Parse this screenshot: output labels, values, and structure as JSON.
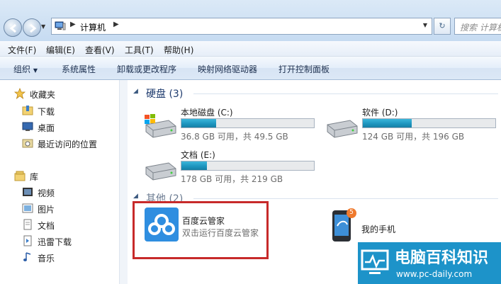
{
  "address": {
    "path": "计算机",
    "search_placeholder": "搜索 计算机"
  },
  "menu": [
    "文件(F)",
    "编辑(E)",
    "查看(V)",
    "工具(T)",
    "帮助(H)"
  ],
  "toolbar": {
    "organize": "组织",
    "system_properties": "系统属性",
    "uninstall": "卸载或更改程序",
    "map_drive": "映射网络驱动器",
    "control_panel": "打开控制面板"
  },
  "sidebar": {
    "favorites": "收藏夹",
    "downloads": "下载",
    "desktop": "桌面",
    "recent": "最近访问的位置",
    "libraries": "库",
    "videos": "视频",
    "pictures": "图片",
    "documents": "文档",
    "xunlei": "迅雷下载",
    "music": "音乐"
  },
  "groups": {
    "hard_disks": "硬盘 (3)",
    "others": "其他 (2)"
  },
  "drives": [
    {
      "name": "本地磁盘 (C:)",
      "free_text": "36.8 GB 可用，共 49.5 GB",
      "used_fraction": 0.26
    },
    {
      "name": "软件 (D:)",
      "free_text": "124 GB 可用，共 196 GB",
      "used_fraction": 0.37
    },
    {
      "name": "文档 (E:)",
      "free_text": "178 GB 可用，共 219 GB",
      "used_fraction": 0.19
    }
  ],
  "others": [
    {
      "name": "百度云管家",
      "subtitle": "双击运行百度云管家"
    },
    {
      "name": "我的手机",
      "badge": "5"
    }
  ],
  "watermark": {
    "cn": "电脑百科知识",
    "url": "www.pc-daily.com"
  },
  "colors": {
    "highlight": "#c72a2a",
    "drive_fill": "#1c93bd",
    "watermark_bg": "#1d93c9"
  }
}
